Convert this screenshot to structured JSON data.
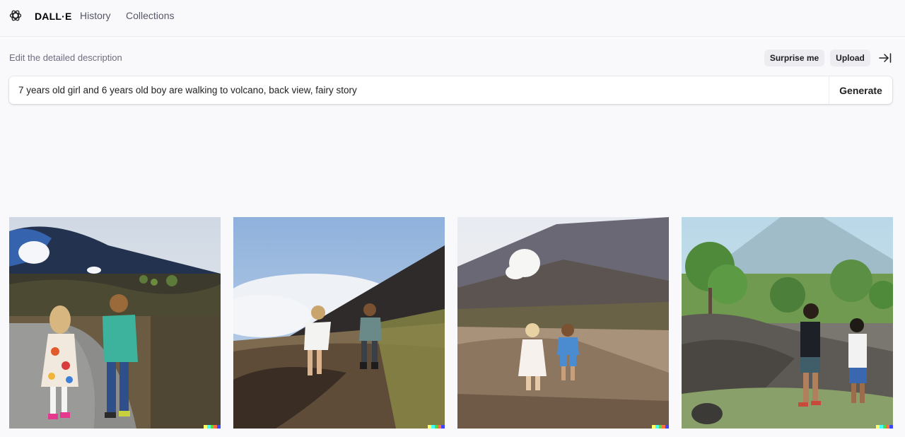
{
  "header": {
    "brand": "DALL·E",
    "nav": [
      "History",
      "Collections"
    ]
  },
  "editor": {
    "label": "Edit the detailed description",
    "surprise_label": "Surprise me",
    "upload_label": "Upload",
    "prompt_value": "7 years old girl and 6 years old boy are walking to volcano, back view, fairy story",
    "generate_label": "Generate"
  },
  "results": {
    "images": [
      {
        "subject": "girl-floral-dress-boy-green-shirt-path-volcano"
      },
      {
        "subject": "children-running-dark-slope-clouds"
      },
      {
        "subject": "children-dirt-path-smoking-volcano"
      },
      {
        "subject": "children-walking-lava-field-green-trees"
      }
    ],
    "signature_colors": [
      "#ffff66",
      "#42ffff",
      "#51da4c",
      "#ff6e3c",
      "#3c46ff"
    ]
  }
}
